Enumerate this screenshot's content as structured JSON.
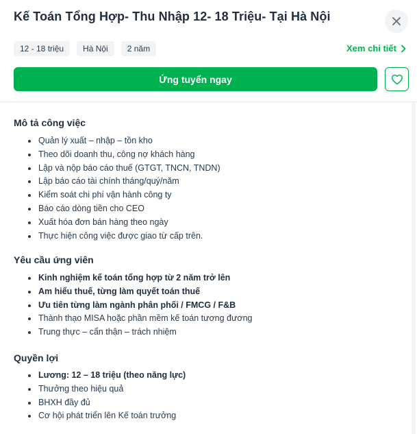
{
  "header": {
    "title": "Kế Toán Tổng Hợp- Thu Nhập 12- 18 Triệu- Tại Hà Nội",
    "tags": [
      "12 - 18 triệu",
      "Hà Nội",
      "2 năm"
    ],
    "detail_link": "Xem chi tiết",
    "apply_label": "Ứng tuyển ngay"
  },
  "icons": {
    "close": "close-icon",
    "chevron": "chevron-right-icon",
    "heart": "heart-icon"
  },
  "colors": {
    "brand": "#00b14f",
    "text": "#212f3f"
  },
  "sections": [
    {
      "title": "Mô tả công việc",
      "items": [
        {
          "text": "Quản lý xuất – nhập – tồn kho",
          "bold": false
        },
        {
          "text": "Theo dõi doanh thu, công nợ khách hàng",
          "bold": false
        },
        {
          "text": "Lập và nộp báo cáo thuế (GTGT, TNCN, TNDN)",
          "bold": false
        },
        {
          "text": "Lập báo cáo tài chính tháng/quý/năm",
          "bold": false
        },
        {
          "text": "Kiểm soát chi phí vận hành công ty",
          "bold": false
        },
        {
          "text": "Báo cáo dòng tiền cho CEO",
          "bold": false
        },
        {
          "text": "Xuất hóa đơn bán hàng theo ngày",
          "bold": false
        },
        {
          "text": "Thực hiện công việc được giao từ cấp trên.",
          "bold": false
        }
      ]
    },
    {
      "title": "Yêu cầu ứng viên",
      "items": [
        {
          "text": "Kinh nghiệm kế toán tổng hợp từ 2 năm trở lên",
          "bold": true
        },
        {
          "text": "Am hiểu thuế, từng làm quyết toán thuế",
          "bold": true
        },
        {
          "text": "Ưu tiên từng làm ngành phân phối / FMCG / F&B",
          "bold": true
        },
        {
          "text": "Thành thạo MISA hoặc phần mềm kế toán tương đương",
          "bold": false
        },
        {
          "text": "Trung thực – cẩn thận – trách nhiệm",
          "bold": false
        }
      ]
    },
    {
      "title": "Quyền lợi",
      "items": [
        {
          "text": "Lương: 12 – 18 triệu (theo năng lực)",
          "bold": true
        },
        {
          "text": "Thưởng theo hiệu quả",
          "bold": false
        },
        {
          "text": "BHXH đầy đủ",
          "bold": false
        },
        {
          "text": "Cơ hội phát triển lên Kế toán trưởng",
          "bold": false
        }
      ]
    }
  ]
}
